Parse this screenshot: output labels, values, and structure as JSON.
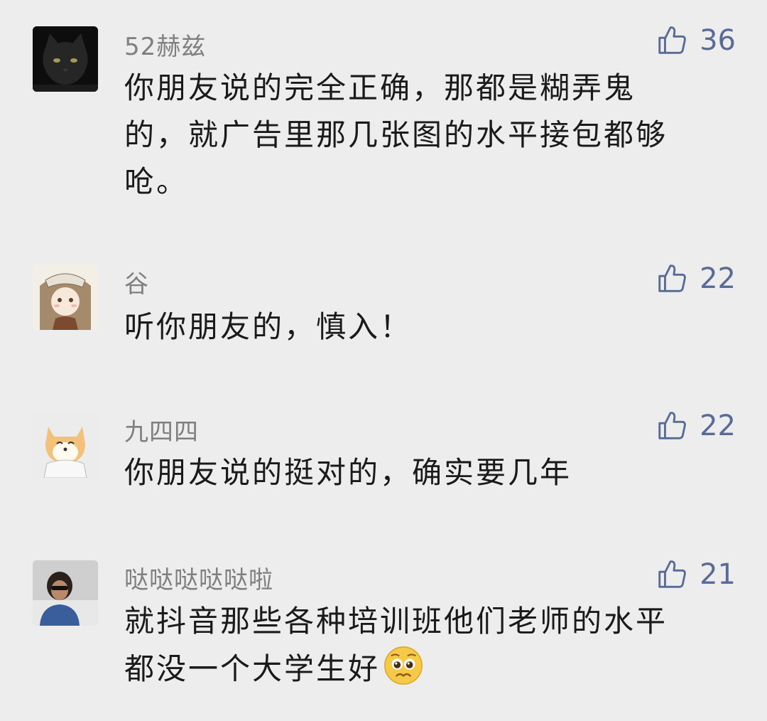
{
  "accent_color": "#576b95",
  "comments": [
    {
      "user": "52赫兹",
      "likes": "36",
      "text": "你朋友说的完全正确，那都是糊弄鬼\n的，就广告里那几张图的水平接包都够\n呛。"
    },
    {
      "user": "谷",
      "likes": "22",
      "text": "听你朋友的，慎入！"
    },
    {
      "user": "九四四",
      "likes": "22",
      "text": "你朋友说的挺对的，确实要几年"
    },
    {
      "user": "哒哒哒哒哒啦",
      "likes": "21",
      "text": "就抖音那些各种培训班他们老师的水平\n都没一个大学生好"
    }
  ]
}
